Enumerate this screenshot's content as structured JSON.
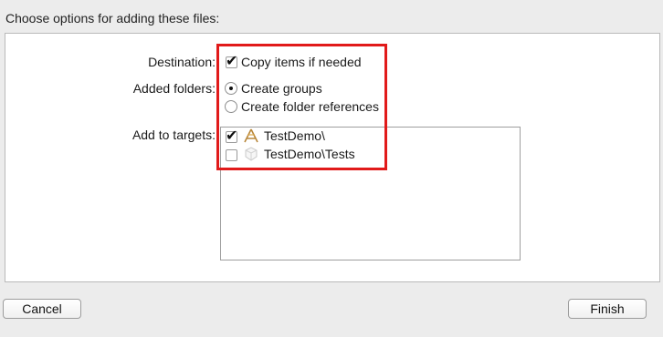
{
  "dialog": {
    "title": "Choose options for adding these files:"
  },
  "destination": {
    "label": "Destination:",
    "copy_items_label": "Copy items if needed",
    "copy_items_checked": true
  },
  "added_folders": {
    "label": "Added folders:",
    "options": [
      {
        "label": "Create groups",
        "selected": true
      },
      {
        "label": "Create folder references",
        "selected": false
      }
    ]
  },
  "targets": {
    "label": "Add to targets:",
    "items": [
      {
        "label": "TestDemo\\",
        "checked": true,
        "icon": "app-target-icon"
      },
      {
        "label": "TestDemo\\Tests",
        "checked": false,
        "icon": "test-bundle-icon"
      }
    ]
  },
  "buttons": {
    "cancel": "Cancel",
    "finish": "Finish"
  },
  "colors": {
    "highlight": "#e11a1a"
  }
}
